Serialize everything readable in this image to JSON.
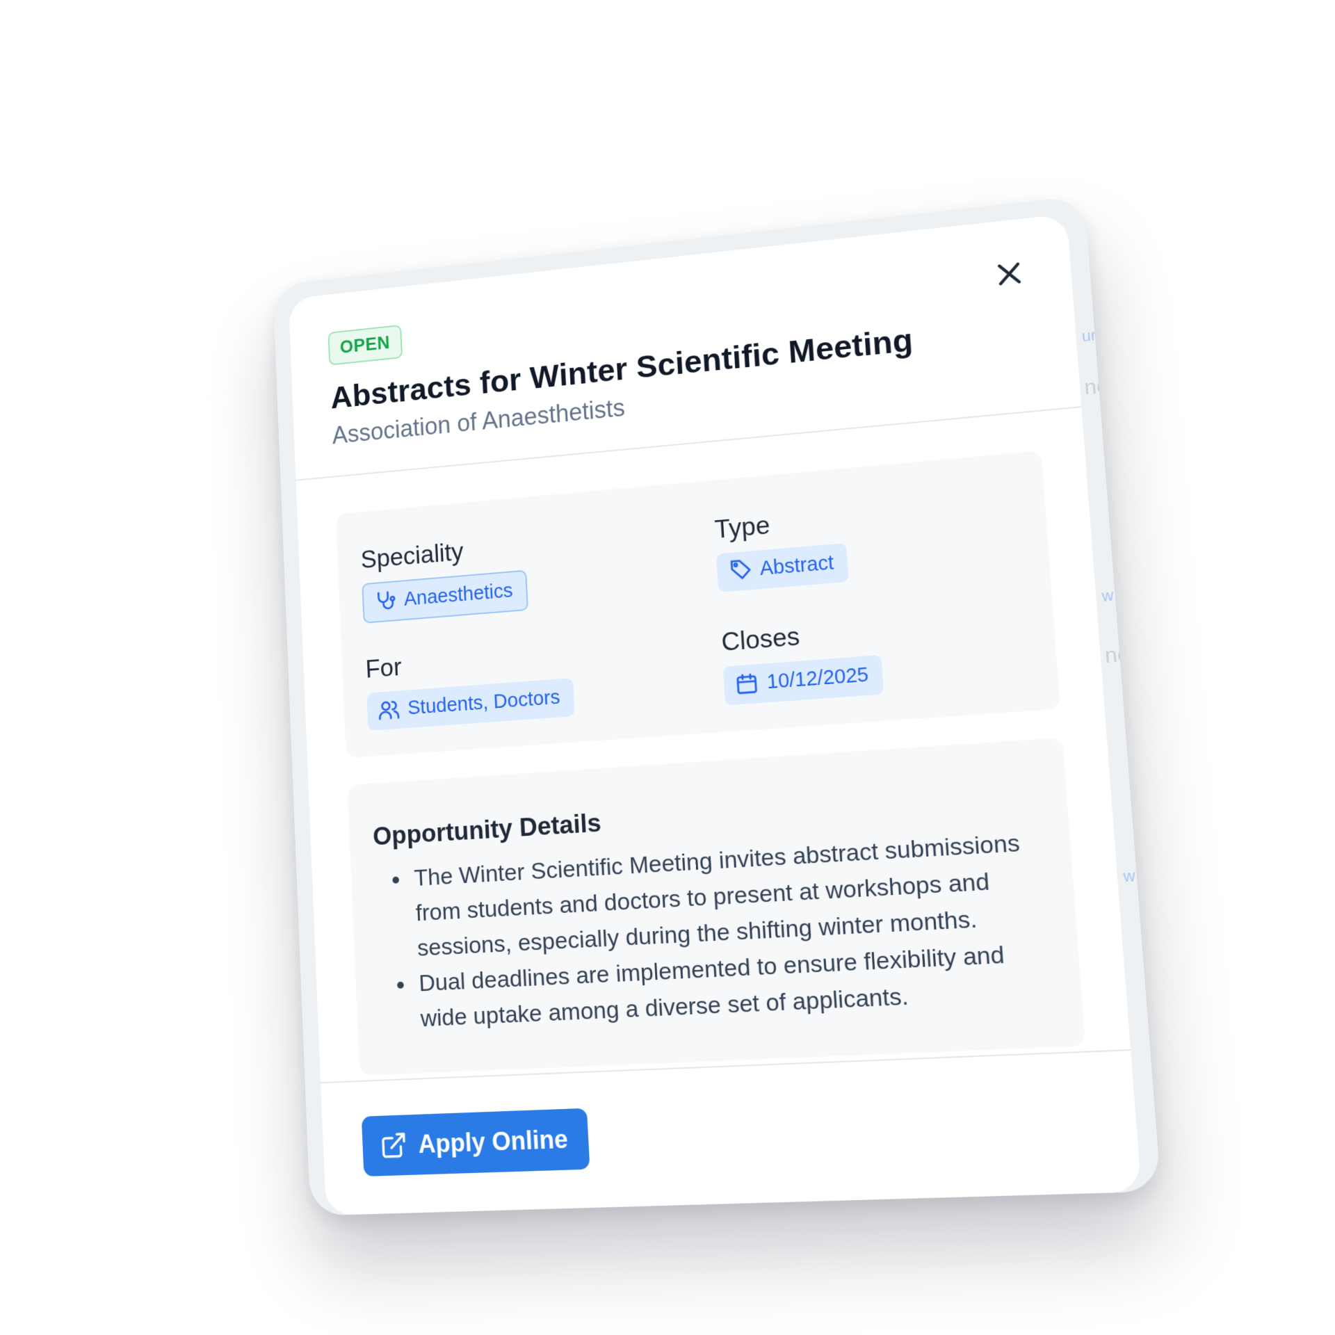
{
  "dialog": {
    "status_badge": "OPEN",
    "title": "Abstracts for Winter Scientific Meeting",
    "organization": "Association of Anaesthetists",
    "close_icon": "close-icon"
  },
  "meta": {
    "speciality": {
      "label": "Speciality",
      "value": "Anaesthetics",
      "icon": "stethoscope-icon"
    },
    "type": {
      "label": "Type",
      "value": "Abstract",
      "icon": "tag-icon"
    },
    "for": {
      "label": "For",
      "value": "Students, Doctors",
      "icon": "users-icon"
    },
    "closes": {
      "label": "Closes",
      "value": "10/12/2025",
      "icon": "calendar-icon"
    }
  },
  "details": {
    "heading": "Opportunity Details",
    "items": [
      "The Winter Scientific Meeting invites abstract submissions from students and doctors to present at workshops and sessions, especially during the shifting winter months.",
      "Dual deadlines are implemented to ensure flexibility and wide uptake among a diverse set of applicants."
    ]
  },
  "footer": {
    "apply_label": "Apply Online",
    "apply_icon": "external-link-icon"
  },
  "colors": {
    "primary": "#2a7be5",
    "open_green": "#16a34a",
    "chip_bg": "#dcebfd",
    "chip_text": "#2563eb"
  }
}
